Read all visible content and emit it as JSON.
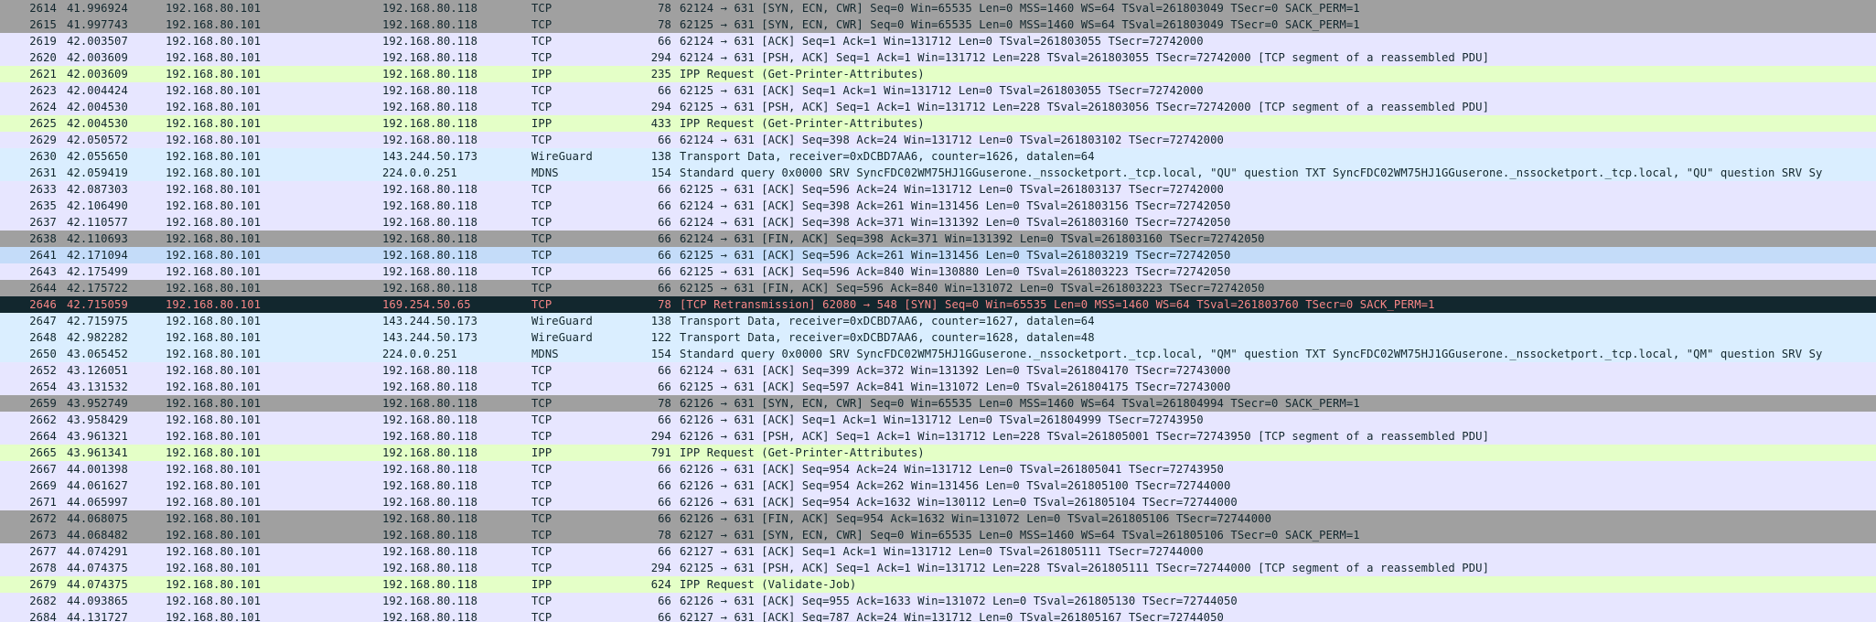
{
  "colors": {
    "tcp": "#e7e6ff",
    "tcp_syn_fin": "#a0a0a0",
    "ipp": "#e4ffc7",
    "wireguard": "#daeeff",
    "mdns": "#daeeff",
    "selected": "#c4dcf9",
    "bad_bg": "#12272e",
    "bad_fg": "#f78787"
  },
  "packets": [
    {
      "no": "2614",
      "time": "41.996924",
      "src": "192.168.80.101",
      "dst": "192.168.80.118",
      "proto": "TCP",
      "len": "78",
      "info": "62124 → 631 [SYN, ECN, CWR] Seq=0 Win=65535 Len=0 MSS=1460 WS=64 TSval=261803049 TSecr=0 SACK_PERM=1",
      "style": "tcpflag"
    },
    {
      "no": "2615",
      "time": "41.997743",
      "src": "192.168.80.101",
      "dst": "192.168.80.118",
      "proto": "TCP",
      "len": "78",
      "info": "62125 → 631 [SYN, ECN, CWR] Seq=0 Win=65535 Len=0 MSS=1460 WS=64 TSval=261803049 TSecr=0 SACK_PERM=1",
      "style": "tcpflag"
    },
    {
      "no": "2619",
      "time": "42.003507",
      "src": "192.168.80.101",
      "dst": "192.168.80.118",
      "proto": "TCP",
      "len": "66",
      "info": "62124 → 631 [ACK] Seq=1 Ack=1 Win=131712 Len=0 TSval=261803055 TSecr=72742000",
      "style": "tcp"
    },
    {
      "no": "2620",
      "time": "42.003609",
      "src": "192.168.80.101",
      "dst": "192.168.80.118",
      "proto": "TCP",
      "len": "294",
      "info": "62124 → 631 [PSH, ACK] Seq=1 Ack=1 Win=131712 Len=228 TSval=261803055 TSecr=72742000 [TCP segment of a reassembled PDU]",
      "style": "tcp"
    },
    {
      "no": "2621",
      "time": "42.003609",
      "src": "192.168.80.101",
      "dst": "192.168.80.118",
      "proto": "IPP",
      "len": "235",
      "info": "IPP Request (Get-Printer-Attributes)",
      "style": "ipp"
    },
    {
      "no": "2623",
      "time": "42.004424",
      "src": "192.168.80.101",
      "dst": "192.168.80.118",
      "proto": "TCP",
      "len": "66",
      "info": "62125 → 631 [ACK] Seq=1 Ack=1 Win=131712 Len=0 TSval=261803055 TSecr=72742000",
      "style": "tcp"
    },
    {
      "no": "2624",
      "time": "42.004530",
      "src": "192.168.80.101",
      "dst": "192.168.80.118",
      "proto": "TCP",
      "len": "294",
      "info": "62125 → 631 [PSH, ACK] Seq=1 Ack=1 Win=131712 Len=228 TSval=261803056 TSecr=72742000 [TCP segment of a reassembled PDU]",
      "style": "tcp"
    },
    {
      "no": "2625",
      "time": "42.004530",
      "src": "192.168.80.101",
      "dst": "192.168.80.118",
      "proto": "IPP",
      "len": "433",
      "info": "IPP Request (Get-Printer-Attributes)",
      "style": "ipp"
    },
    {
      "no": "2629",
      "time": "42.050572",
      "src": "192.168.80.101",
      "dst": "192.168.80.118",
      "proto": "TCP",
      "len": "66",
      "info": "62124 → 631 [ACK] Seq=398 Ack=24 Win=131712 Len=0 TSval=261803102 TSecr=72742000",
      "style": "tcp"
    },
    {
      "no": "2630",
      "time": "42.055650",
      "src": "192.168.80.101",
      "dst": "143.244.50.173",
      "proto": "WireGuard",
      "len": "138",
      "info": "Transport Data, receiver=0xDCBD7AA6, counter=1626, datalen=64",
      "style": "wg"
    },
    {
      "no": "2631",
      "time": "42.059419",
      "src": "192.168.80.101",
      "dst": "224.0.0.251",
      "proto": "MDNS",
      "len": "154",
      "info": "Standard query 0x0000 SRV SyncFDC02WM75HJ1GGuserone._nssocketport._tcp.local, \"QU\" question TXT SyncFDC02WM75HJ1GGuserone._nssocketport._tcp.local, \"QU\" question SRV Sy",
      "style": "mdns"
    },
    {
      "no": "2633",
      "time": "42.087303",
      "src": "192.168.80.101",
      "dst": "192.168.80.118",
      "proto": "TCP",
      "len": "66",
      "info": "62125 → 631 [ACK] Seq=596 Ack=24 Win=131712 Len=0 TSval=261803137 TSecr=72742000",
      "style": "tcp"
    },
    {
      "no": "2635",
      "time": "42.106490",
      "src": "192.168.80.101",
      "dst": "192.168.80.118",
      "proto": "TCP",
      "len": "66",
      "info": "62124 → 631 [ACK] Seq=398 Ack=261 Win=131456 Len=0 TSval=261803156 TSecr=72742050",
      "style": "tcp"
    },
    {
      "no": "2637",
      "time": "42.110577",
      "src": "192.168.80.101",
      "dst": "192.168.80.118",
      "proto": "TCP",
      "len": "66",
      "info": "62124 → 631 [ACK] Seq=398 Ack=371 Win=131392 Len=0 TSval=261803160 TSecr=72742050",
      "style": "tcp"
    },
    {
      "no": "2638",
      "time": "42.110693",
      "src": "192.168.80.101",
      "dst": "192.168.80.118",
      "proto": "TCP",
      "len": "66",
      "info": "62124 → 631 [FIN, ACK] Seq=398 Ack=371 Win=131392 Len=0 TSval=261803160 TSecr=72742050",
      "style": "tcpflag"
    },
    {
      "no": "2641",
      "time": "42.171094",
      "src": "192.168.80.101",
      "dst": "192.168.80.118",
      "proto": "TCP",
      "len": "66",
      "info": "62125 → 631 [ACK] Seq=596 Ack=261 Win=131456 Len=0 TSval=261803219 TSecr=72742050",
      "style": "selected"
    },
    {
      "no": "2643",
      "time": "42.175499",
      "src": "192.168.80.101",
      "dst": "192.168.80.118",
      "proto": "TCP",
      "len": "66",
      "info": "62125 → 631 [ACK] Seq=596 Ack=840 Win=130880 Len=0 TSval=261803223 TSecr=72742050",
      "style": "tcp"
    },
    {
      "no": "2644",
      "time": "42.175722",
      "src": "192.168.80.101",
      "dst": "192.168.80.118",
      "proto": "TCP",
      "len": "66",
      "info": "62125 → 631 [FIN, ACK] Seq=596 Ack=840 Win=131072 Len=0 TSval=261803223 TSecr=72742050",
      "style": "tcpflag"
    },
    {
      "no": "2646",
      "time": "42.715059",
      "src": "192.168.80.101",
      "dst": "169.254.50.65",
      "proto": "TCP",
      "len": "78",
      "info": "[TCP Retransmission] 62080 → 548 [SYN] Seq=0 Win=65535 Len=0 MSS=1460 WS=64 TSval=261803760 TSecr=0 SACK_PERM=1",
      "style": "bad"
    },
    {
      "no": "2647",
      "time": "42.715975",
      "src": "192.168.80.101",
      "dst": "143.244.50.173",
      "proto": "WireGuard",
      "len": "138",
      "info": "Transport Data, receiver=0xDCBD7AA6, counter=1627, datalen=64",
      "style": "wg"
    },
    {
      "no": "2648",
      "time": "42.982282",
      "src": "192.168.80.101",
      "dst": "143.244.50.173",
      "proto": "WireGuard",
      "len": "122",
      "info": "Transport Data, receiver=0xDCBD7AA6, counter=1628, datalen=48",
      "style": "wg"
    },
    {
      "no": "2650",
      "time": "43.065452",
      "src": "192.168.80.101",
      "dst": "224.0.0.251",
      "proto": "MDNS",
      "len": "154",
      "info": "Standard query 0x0000 SRV SyncFDC02WM75HJ1GGuserone._nssocketport._tcp.local, \"QM\" question TXT SyncFDC02WM75HJ1GGuserone._nssocketport._tcp.local, \"QM\" question SRV Sy",
      "style": "mdns"
    },
    {
      "no": "2652",
      "time": "43.126051",
      "src": "192.168.80.101",
      "dst": "192.168.80.118",
      "proto": "TCP",
      "len": "66",
      "info": "62124 → 631 [ACK] Seq=399 Ack=372 Win=131392 Len=0 TSval=261804170 TSecr=72743000",
      "style": "tcp"
    },
    {
      "no": "2654",
      "time": "43.131532",
      "src": "192.168.80.101",
      "dst": "192.168.80.118",
      "proto": "TCP",
      "len": "66",
      "info": "62125 → 631 [ACK] Seq=597 Ack=841 Win=131072 Len=0 TSval=261804175 TSecr=72743000",
      "style": "tcp"
    },
    {
      "no": "2659",
      "time": "43.952749",
      "src": "192.168.80.101",
      "dst": "192.168.80.118",
      "proto": "TCP",
      "len": "78",
      "info": "62126 → 631 [SYN, ECN, CWR] Seq=0 Win=65535 Len=0 MSS=1460 WS=64 TSval=261804994 TSecr=0 SACK_PERM=1",
      "style": "tcpflag"
    },
    {
      "no": "2662",
      "time": "43.958429",
      "src": "192.168.80.101",
      "dst": "192.168.80.118",
      "proto": "TCP",
      "len": "66",
      "info": "62126 → 631 [ACK] Seq=1 Ack=1 Win=131712 Len=0 TSval=261804999 TSecr=72743950",
      "style": "tcp"
    },
    {
      "no": "2664",
      "time": "43.961321",
      "src": "192.168.80.101",
      "dst": "192.168.80.118",
      "proto": "TCP",
      "len": "294",
      "info": "62126 → 631 [PSH, ACK] Seq=1 Ack=1 Win=131712 Len=228 TSval=261805001 TSecr=72743950 [TCP segment of a reassembled PDU]",
      "style": "tcp"
    },
    {
      "no": "2665",
      "time": "43.961341",
      "src": "192.168.80.101",
      "dst": "192.168.80.118",
      "proto": "IPP",
      "len": "791",
      "info": "IPP Request (Get-Printer-Attributes)",
      "style": "ipp"
    },
    {
      "no": "2667",
      "time": "44.001398",
      "src": "192.168.80.101",
      "dst": "192.168.80.118",
      "proto": "TCP",
      "len": "66",
      "info": "62126 → 631 [ACK] Seq=954 Ack=24 Win=131712 Len=0 TSval=261805041 TSecr=72743950",
      "style": "tcp"
    },
    {
      "no": "2669",
      "time": "44.061627",
      "src": "192.168.80.101",
      "dst": "192.168.80.118",
      "proto": "TCP",
      "len": "66",
      "info": "62126 → 631 [ACK] Seq=954 Ack=262 Win=131456 Len=0 TSval=261805100 TSecr=72744000",
      "style": "tcp"
    },
    {
      "no": "2671",
      "time": "44.065997",
      "src": "192.168.80.101",
      "dst": "192.168.80.118",
      "proto": "TCP",
      "len": "66",
      "info": "62126 → 631 [ACK] Seq=954 Ack=1632 Win=130112 Len=0 TSval=261805104 TSecr=72744000",
      "style": "tcp"
    },
    {
      "no": "2672",
      "time": "44.068075",
      "src": "192.168.80.101",
      "dst": "192.168.80.118",
      "proto": "TCP",
      "len": "66",
      "info": "62126 → 631 [FIN, ACK] Seq=954 Ack=1632 Win=131072 Len=0 TSval=261805106 TSecr=72744000",
      "style": "tcpflag"
    },
    {
      "no": "2673",
      "time": "44.068482",
      "src": "192.168.80.101",
      "dst": "192.168.80.118",
      "proto": "TCP",
      "len": "78",
      "info": "62127 → 631 [SYN, ECN, CWR] Seq=0 Win=65535 Len=0 MSS=1460 WS=64 TSval=261805106 TSecr=0 SACK_PERM=1",
      "style": "tcpflag"
    },
    {
      "no": "2677",
      "time": "44.074291",
      "src": "192.168.80.101",
      "dst": "192.168.80.118",
      "proto": "TCP",
      "len": "66",
      "info": "62127 → 631 [ACK] Seq=1 Ack=1 Win=131712 Len=0 TSval=261805111 TSecr=72744000",
      "style": "tcp"
    },
    {
      "no": "2678",
      "time": "44.074375",
      "src": "192.168.80.101",
      "dst": "192.168.80.118",
      "proto": "TCP",
      "len": "294",
      "info": "62125 → 631 [PSH, ACK] Seq=1 Ack=1 Win=131712 Len=228 TSval=261805111 TSecr=72744000 [TCP segment of a reassembled PDU]",
      "style": "tcp"
    },
    {
      "no": "2679",
      "time": "44.074375",
      "src": "192.168.80.101",
      "dst": "192.168.80.118",
      "proto": "IPP",
      "len": "624",
      "info": "IPP Request (Validate-Job)",
      "style": "ipp"
    },
    {
      "no": "2682",
      "time": "44.093865",
      "src": "192.168.80.101",
      "dst": "192.168.80.118",
      "proto": "TCP",
      "len": "66",
      "info": "62126 → 631 [ACK] Seq=955 Ack=1633 Win=131072 Len=0 TSval=261805130 TSecr=72744050",
      "style": "tcp"
    },
    {
      "no": "2684",
      "time": "44.131727",
      "src": "192.168.80.101",
      "dst": "192.168.80.118",
      "proto": "TCP",
      "len": "66",
      "info": "62127 → 631 [ACK] Seq=787 Ack=24 Win=131712 Len=0 TSval=261805167 TSecr=72744050",
      "style": "tcp"
    }
  ]
}
